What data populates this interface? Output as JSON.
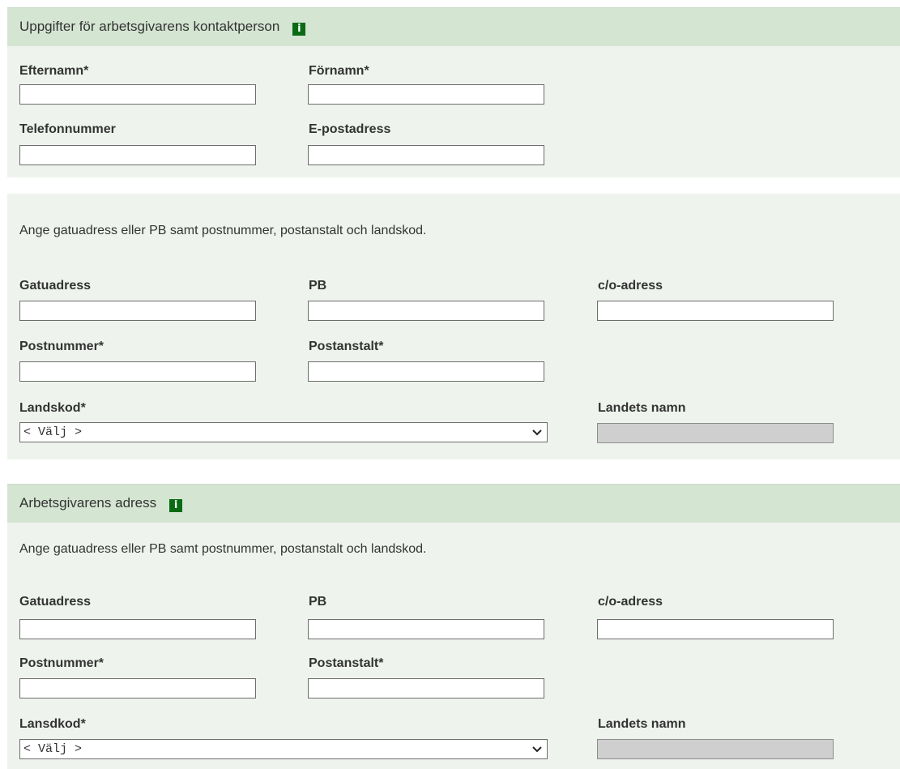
{
  "contact_section": {
    "title": "Uppgifter för arbetsgivarens kontaktperson",
    "info_icon": "info-icon",
    "fields": {
      "last_name_label": "Efternamn*",
      "last_name_value": "",
      "first_name_label": "Förnamn*",
      "first_name_value": "",
      "phone_label": "Telefonnummer",
      "phone_value": "",
      "email_label": "E-postadress",
      "email_value": ""
    }
  },
  "contact_address_section": {
    "instruction": "Ange gatuadress eller PB samt postnummer, postanstalt och landskod.",
    "street_label": "Gatuadress",
    "street_value": "",
    "pobox_label": "PB",
    "pobox_value": "",
    "co_label": "c/o-adress",
    "co_value": "",
    "postal_code_label": "Postnummer*",
    "postal_code_value": "",
    "post_office_label": "Postanstalt*",
    "post_office_value": "",
    "country_code_label": "Landskod*",
    "country_code_selected": "< Välj >",
    "country_name_label": "Landets namn",
    "country_name_value": ""
  },
  "employer_address_section": {
    "title": "Arbetsgivarens adress",
    "info_icon": "info-icon",
    "instruction": "Ange gatuadress eller PB samt postnummer, postanstalt och landskod.",
    "street_label": "Gatuadress",
    "street_value": "",
    "pobox_label": "PB",
    "pobox_value": "",
    "co_label": "c/o-adress",
    "co_value": "",
    "postal_code_label": "Postnummer*",
    "postal_code_value": "",
    "post_office_label": "Postanstalt*",
    "post_office_value": "",
    "country_code_label": "Lansdkod*",
    "country_code_selected": "< Välj >",
    "country_name_label": "Landets namn",
    "country_name_value": ""
  },
  "colors": {
    "header_bg": "#d4e5d2",
    "panel_bg": "#eef4ed",
    "info_icon_bg": "#0b6b15",
    "readonly_field_bg": "#cfcfcf",
    "text": "#333333"
  }
}
